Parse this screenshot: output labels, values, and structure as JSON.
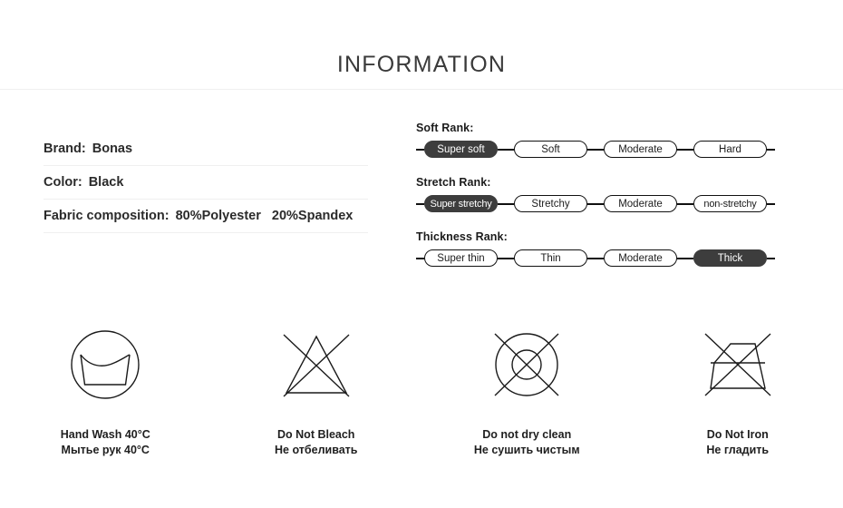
{
  "header": {
    "title": "INFORMATION"
  },
  "specs": [
    {
      "label": "Brand:",
      "value": "Bonas"
    },
    {
      "label": "Color:",
      "value": "Black"
    },
    {
      "label": "Fabric composition:",
      "value": "80%Polyester",
      "value2": "20%Spandex"
    }
  ],
  "ranks": [
    {
      "title": "Soft Rank:",
      "options": [
        {
          "label": "Super soft",
          "active": true
        },
        {
          "label": "Soft",
          "active": false
        },
        {
          "label": "Moderate",
          "active": false
        },
        {
          "label": "Hard",
          "active": false
        }
      ]
    },
    {
      "title": "Stretch Rank:",
      "options": [
        {
          "label": "Super stretchy",
          "active": true
        },
        {
          "label": "Stretchy",
          "active": false
        },
        {
          "label": "Moderate",
          "active": false
        },
        {
          "label": "non-stretchy",
          "active": false
        }
      ]
    },
    {
      "title": "Thickness Rank:",
      "options": [
        {
          "label": "Super thin",
          "active": false
        },
        {
          "label": "Thin",
          "active": false
        },
        {
          "label": "Moderate",
          "active": false
        },
        {
          "label": "Thick",
          "active": true
        }
      ]
    }
  ],
  "care_symbols": [
    {
      "icon": "hand-wash-icon",
      "caption_en": "Hand Wash 40°C",
      "caption_ru": "Мытье рук 40°C"
    },
    {
      "icon": "do-not-bleach-icon",
      "caption_en": "Do Not Bleach",
      "caption_ru": "Не отбеливать"
    },
    {
      "icon": "do-not-dry-clean-icon",
      "caption_en": "Do not dry clean",
      "caption_ru": "Не сушить чистым"
    },
    {
      "icon": "do-not-iron-icon",
      "caption_en": "Do Not Iron",
      "caption_ru": "Не гладить"
    }
  ],
  "colors": {
    "active_pill": "#3d3d3d",
    "line": "#111111",
    "text": "#1f1f1f",
    "divider": "#efefef"
  }
}
